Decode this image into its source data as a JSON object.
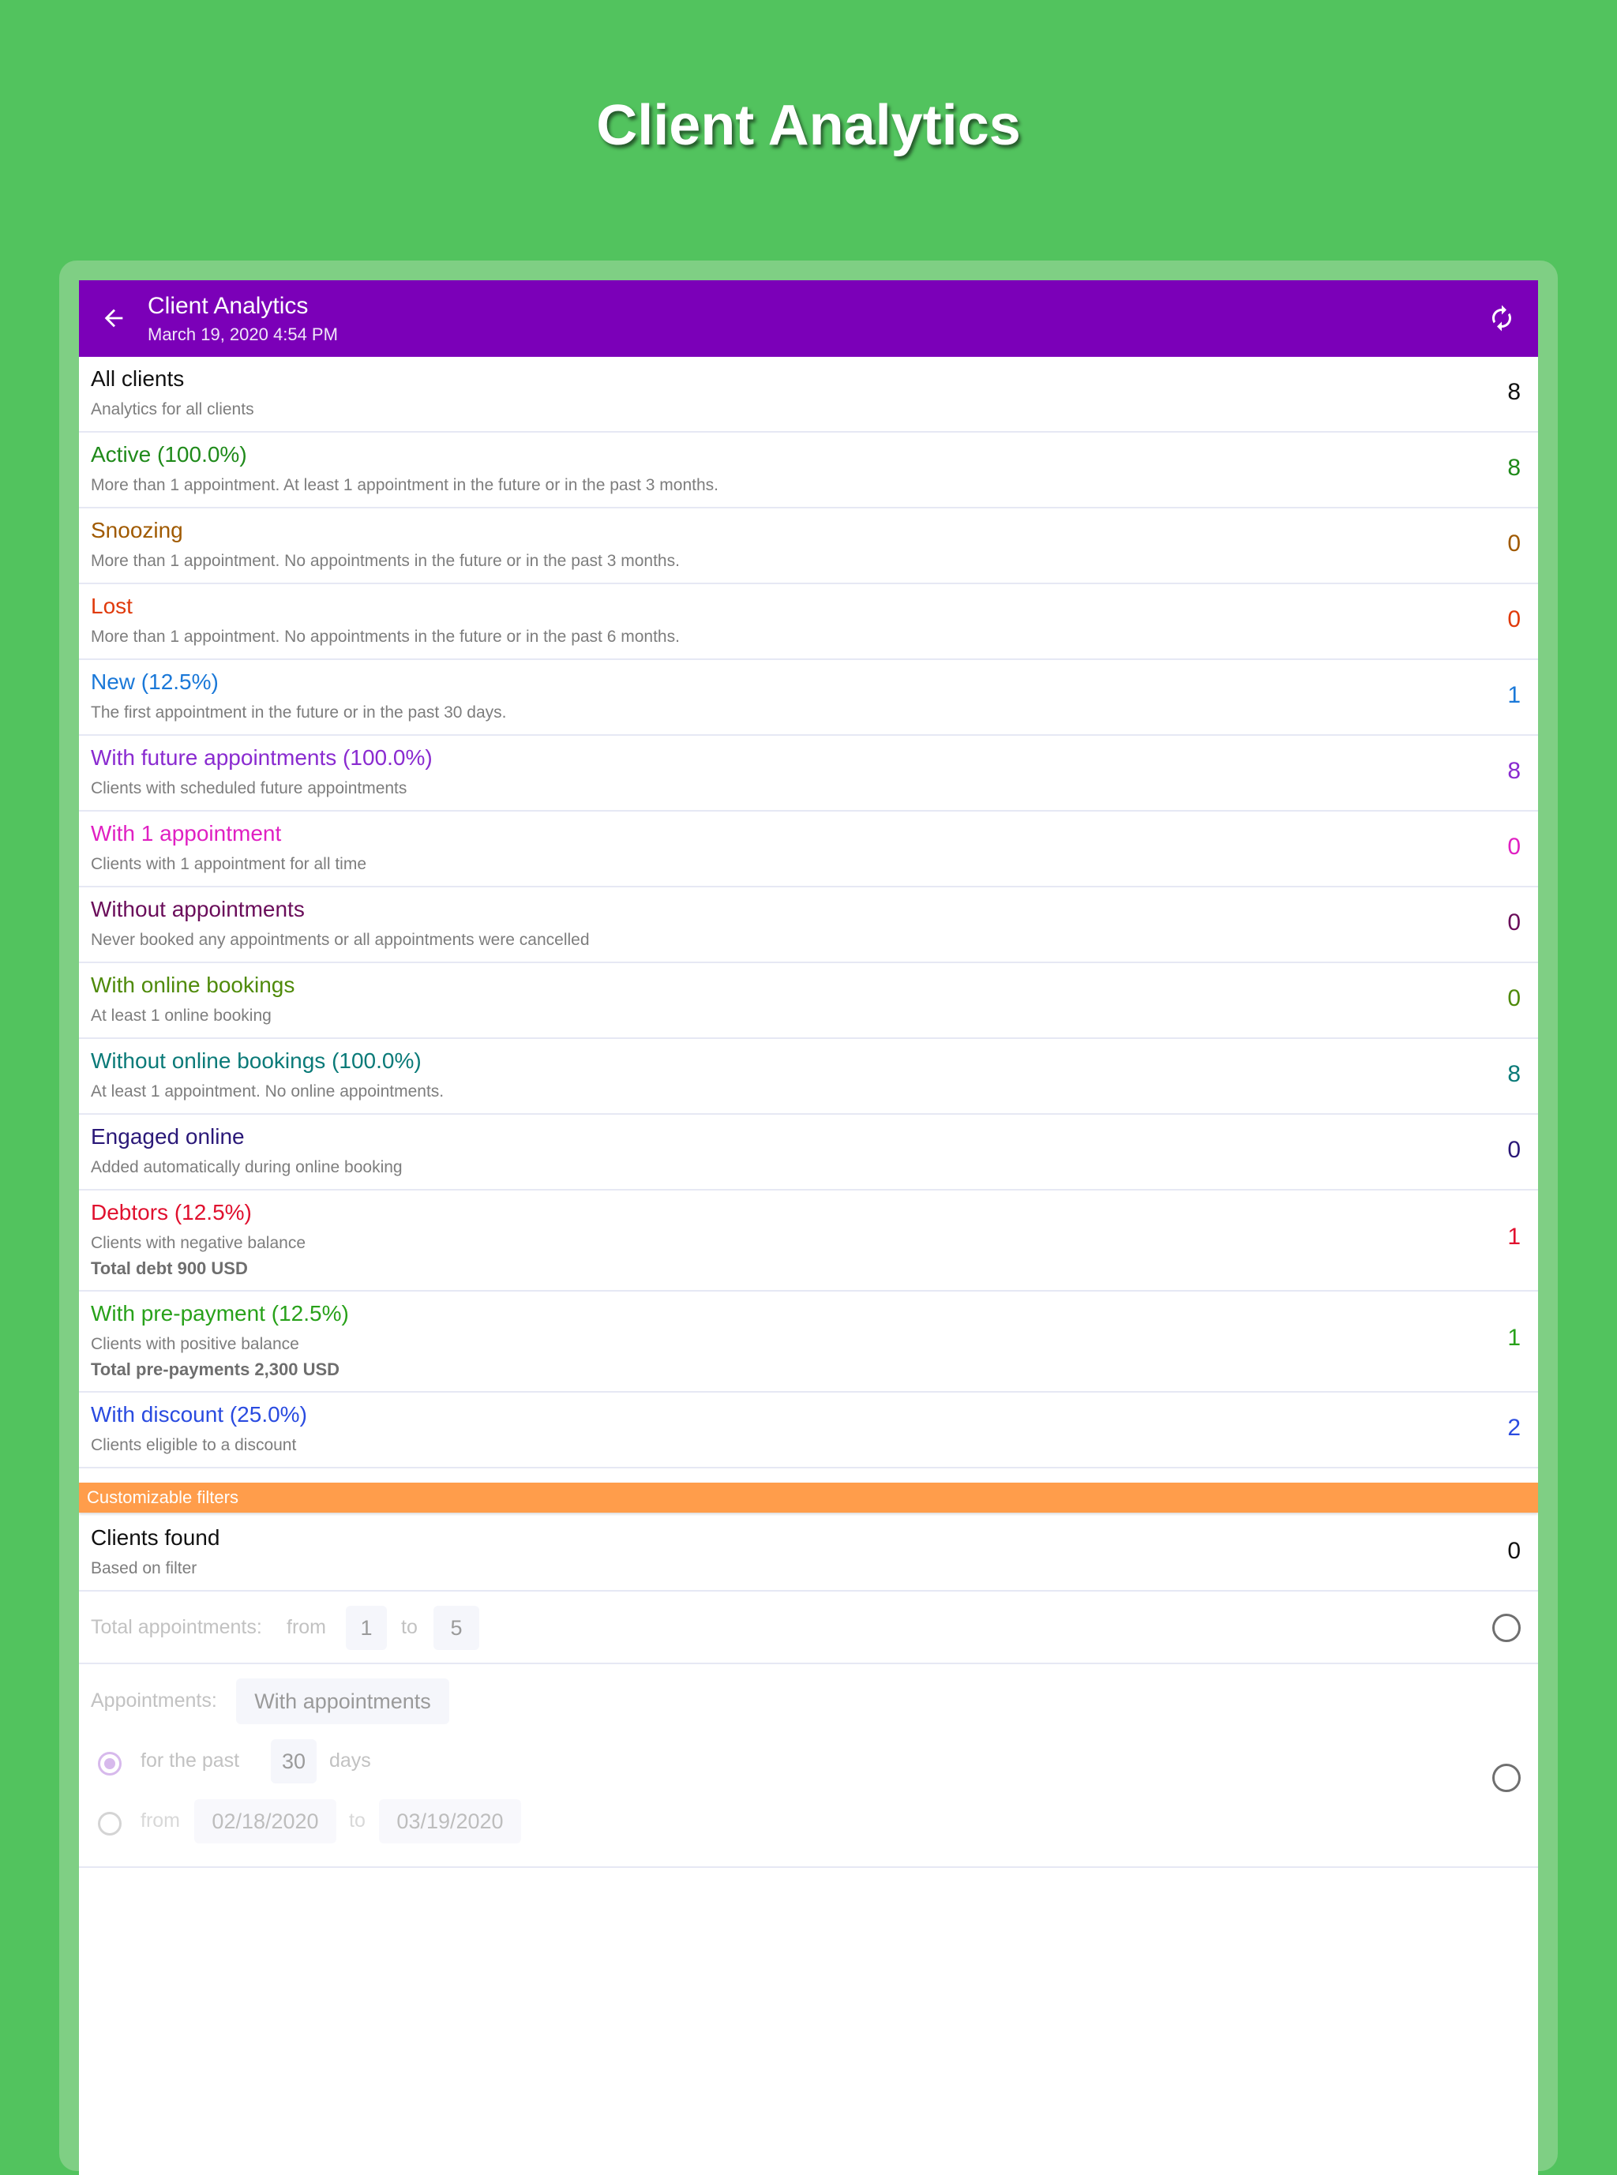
{
  "promo": {
    "title": "Client Analytics"
  },
  "app_bar": {
    "title": "Client Analytics",
    "subtitle": "March 19, 2020 4:54 PM",
    "back_icon": "arrow-left-icon",
    "refresh_icon": "refresh-icon"
  },
  "rows": [
    {
      "label": "All clients",
      "desc": "Analytics for all clients",
      "count": "8",
      "color": "#111111"
    },
    {
      "label": "Active (100.0%)",
      "desc": "More than 1 appointment. At least 1 appointment in the future or in the past 3 months.",
      "count": "8",
      "color": "#1f8a1a"
    },
    {
      "label": "Snoozing",
      "desc": "More than 1 appointment. No appointments in the future or in the past 3 months.",
      "count": "0",
      "color": "#a05a00"
    },
    {
      "label": "Lost",
      "desc": "More than 1 appointment. No appointments in the future or in the past 6 months.",
      "count": "0",
      "color": "#e03a0b"
    },
    {
      "label": "New (12.5%)",
      "desc": "The first appointment in the future or in the past 30 days.",
      "count": "1",
      "color": "#1a78d8"
    },
    {
      "label": "With future appointments (100.0%)",
      "desc": "Clients with scheduled future appointments",
      "count": "8",
      "color": "#8a2bd0"
    },
    {
      "label": "With 1 appointment",
      "desc": "Clients with 1 appointment for all time",
      "count": "0",
      "color": "#e020c2"
    },
    {
      "label": "Without appointments",
      "desc": "Never booked any appointments or all appointments were cancelled",
      "count": "0",
      "color": "#6a0d5a"
    },
    {
      "label": "With online bookings",
      "desc": "At least 1 online booking",
      "count": "0",
      "color": "#4f8a0a"
    },
    {
      "label": "Without online bookings (100.0%)",
      "desc": "At least 1 appointment. No online appointments.",
      "count": "8",
      "color": "#0a7a78"
    },
    {
      "label": "Engaged online",
      "desc": "Added automatically during online booking",
      "count": "0",
      "color": "#2a1878"
    },
    {
      "label": "Debtors (12.5%)",
      "desc": "Clients with negative balance",
      "extra": "Total debt 900 USD",
      "count": "1",
      "color": "#e0102e"
    },
    {
      "label": "With pre-payment (12.5%)",
      "desc": "Clients with positive balance",
      "extra": "Total pre-payments 2,300 USD",
      "count": "1",
      "color": "#28a11a"
    },
    {
      "label": "With discount (25.0%)",
      "desc": "Clients eligible to a discount",
      "count": "2",
      "color": "#2a4be0"
    }
  ],
  "filters": {
    "section_title": "Customizable filters",
    "found_label": "Clients found",
    "found_desc": "Based on filter",
    "found_count": "0",
    "total_appointments": {
      "label": "Total appointments:",
      "from_label": "from",
      "from_value": "1",
      "to_label": "to",
      "to_value": "5"
    },
    "appointments": {
      "label": "Appointments:",
      "value": "With appointments",
      "past_label": "for the past",
      "past_value": "30",
      "days_label": "days",
      "from_label": "from",
      "from_date": "02/18/2020",
      "to_label": "to",
      "to_date": "03/19/2020"
    }
  },
  "colors": {
    "background": "#52c35e",
    "app_bar": "#7b00b8",
    "section_header": "#ff9d4b"
  }
}
